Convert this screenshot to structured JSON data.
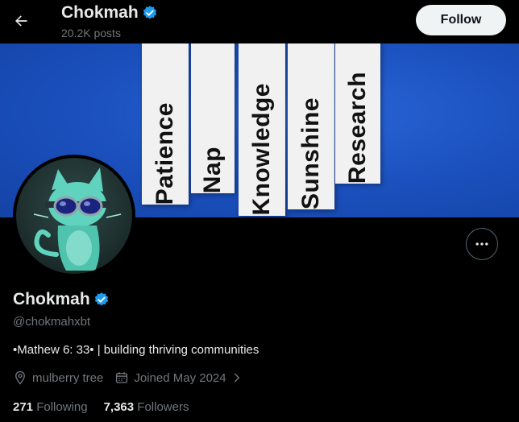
{
  "header": {
    "name": "Chokmah",
    "posts_count": "20.2K posts",
    "follow_label": "Follow"
  },
  "banner": {
    "words": [
      "Patience",
      "Nap",
      "Knowledge",
      "Sunshine",
      "Research"
    ]
  },
  "profile": {
    "name": "Chokmah",
    "handle": "@chokmahxbt",
    "bio": "•Mathew 6: 33•  | building thriving communities",
    "location": "mulberry tree",
    "joined": "Joined May 2024"
  },
  "stats": {
    "following_count": "271",
    "following_label": "Following",
    "followers_count": "7,363",
    "followers_label": "Followers"
  },
  "colors": {
    "verified": "#1d9bf0",
    "banner": "#1d56c4"
  },
  "icons": {
    "back": "arrow-left-icon",
    "verified": "verified-badge-icon",
    "more": "more-horizontal-icon",
    "location": "location-pin-icon",
    "calendar": "calendar-icon",
    "chevron": "chevron-right-icon"
  }
}
